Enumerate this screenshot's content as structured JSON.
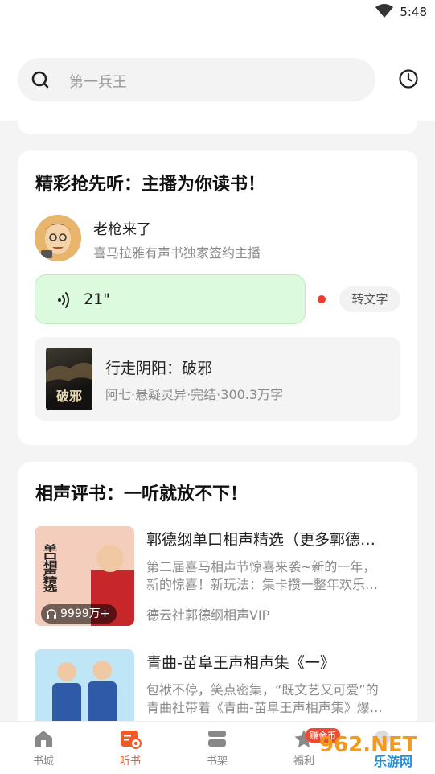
{
  "status_bar": {
    "time": "5:48"
  },
  "search": {
    "placeholder": "第一兵王"
  },
  "section1": {
    "title": "精彩抢先听：主播为你读书！",
    "host": {
      "name": "老枪来了",
      "desc": "喜马拉雅有声书独家签约主播"
    },
    "voice": {
      "duration": "21\"",
      "to_text_label": "转文字"
    },
    "book": {
      "title": "行走阴阳：破邪",
      "meta": "阿七·悬疑灵异·完结·300.3万字",
      "cover_text": "破邪"
    }
  },
  "section2": {
    "title": "相声评书：一听就放不下！",
    "items": [
      {
        "title": "郭德纲单口相声精选（更多郭德…",
        "desc_line1": "第二届喜马相声节惊喜来袭~新的一年，",
        "desc_line2": "新的惊喜！新玩法：集卡攒一整年欢乐…",
        "author": "德云社郭德纲相声VIP",
        "play_count": "9999万+",
        "thumb_text": "单口相声精选"
      },
      {
        "title": "青曲-苗阜王声相声集《一》",
        "desc_line1": "包袱不停，笑点密集，“既文艺又可爱”的",
        "desc_line2": "青曲社带着《青曲-苗阜王声相声集》爆…",
        "author": "",
        "play_count": "",
        "thumb_text": ""
      }
    ]
  },
  "tabbar": {
    "tabs": [
      {
        "label": "书城",
        "icon": "home-icon"
      },
      {
        "label": "听书",
        "icon": "listen-icon",
        "active": true
      },
      {
        "label": "书架",
        "icon": "bookshelf-icon"
      },
      {
        "label": "福利",
        "icon": "star-icon"
      }
    ],
    "welfare_badge": "赚金币"
  },
  "watermark": {
    "text": "962.NET",
    "subtext": "乐游网"
  },
  "colors": {
    "accent": "#f15a24",
    "voice_bg": "#dcfadd",
    "red_dot": "#ef3a2e"
  }
}
